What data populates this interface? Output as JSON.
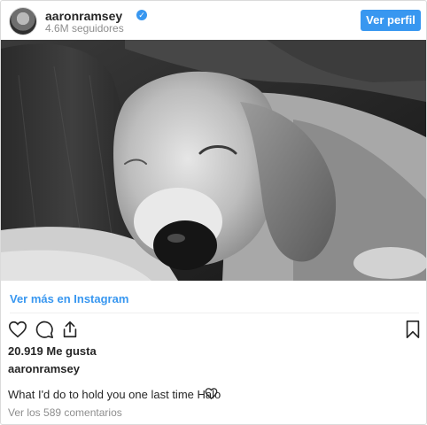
{
  "header": {
    "username": "aaronramsey",
    "followers": "4.6M seguidores",
    "view_profile_label": "Ver perfil",
    "verified_icon": "verified-badge-icon"
  },
  "post": {
    "image_icon": "beagle-photo",
    "view_more_label": "Ver más en Instagram",
    "likes": "20.919 Me gusta",
    "caption_user": "aaronramsey",
    "caption": "What I'd do to hold you one last time Halo",
    "comments_link": "Ver los 589 comentarios"
  },
  "actions": {
    "icons": [
      "heart-icon",
      "comment-icon",
      "share-icon",
      "bookmark-icon"
    ]
  },
  "colors": {
    "accent": "#3897f0",
    "text": "#262626",
    "muted": "#8e8e8e",
    "border": "#dbdbdb"
  }
}
